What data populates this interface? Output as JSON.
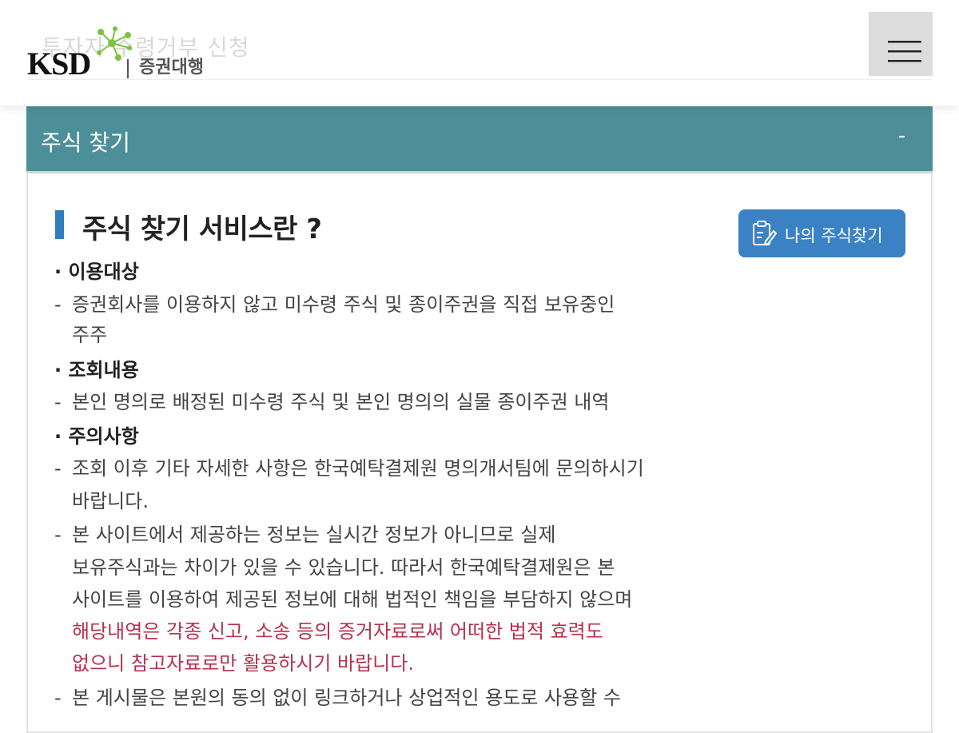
{
  "header": {
    "ghost_title": "투자자 수령거부 신청",
    "logo_text": "KSD",
    "logo_sub": "증권대행"
  },
  "section": {
    "title": "주식 찾기",
    "toggle": "-"
  },
  "content": {
    "heading": "주식 찾기 서비스란 ?",
    "find_button": "나의 주식찾기",
    "categories": [
      {
        "label": "· 이용대상",
        "lines": [
          "증권회사를 이용하지 않고 미수령 주식 및 종이주권을 직접 보유중인",
          "주주"
        ]
      },
      {
        "label": "· 조회내용",
        "lines": [
          "본인 명의로 배정된 미수령 주식 및 본인 명의의 실물 종이주권 내역"
        ]
      },
      {
        "label": "· 주의사항",
        "items": [
          [
            "조회 이후 기타 자세한 사항은 한국예탁결제원 명의개서팀에 문의하시기",
            "바랍니다."
          ],
          [
            "본 사이트에서 제공하는 정보는 실시간 정보가 아니므로 실제",
            "보유주식과는 차이가 있을 수 있습니다. 따라서 한국예탁결제원은 본",
            "사이트를 이용하여 제공된 정보에 대해 법적인 책임을 부담하지 않으며",
            "해당내역은 각종 신고, 소송 등의 증거자료로써 어떠한 법적 효력도",
            "없으니 참고자료로만 활용하시기 바랍니다."
          ],
          [
            "본 게시물은 본원의 동의 없이 링크하거나 상업적인 용도로 사용할 수"
          ]
        ]
      }
    ],
    "dash": "-"
  },
  "colors": {
    "section_bar": "#4d8f99",
    "heading_accent": "#2e7dbd",
    "button": "#3a82c4",
    "warning_text": "#b5314f"
  },
  "icons": [
    "menu-icon",
    "clipboard-edit-icon",
    "ksd-molecule-icon"
  ]
}
